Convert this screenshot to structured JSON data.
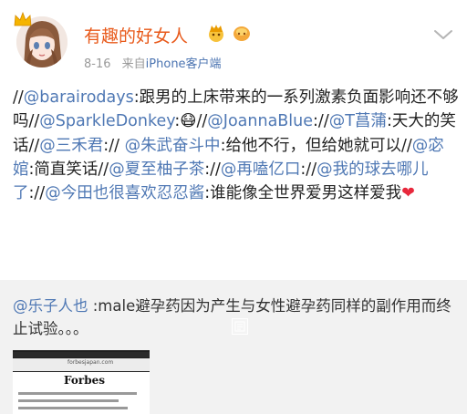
{
  "post": {
    "username": "有趣的好女人",
    "date": "8-16",
    "source_prefix": "来自",
    "device": "iPhone客户端",
    "content": [
      {
        "t": "//",
        "m": false
      },
      {
        "t": "@barairodays",
        "m": true
      },
      {
        "t": ":跟男的上床带来的一系列激素负面影响还不够吗//",
        "m": false
      },
      {
        "t": "@SparkleDonkey",
        "m": true
      },
      {
        "t": ":",
        "m": false
      },
      {
        "t": "😷",
        "m": false
      },
      {
        "t": "//",
        "m": false
      },
      {
        "t": "@JoannaBlue",
        "m": true
      },
      {
        "t": "://",
        "m": false
      },
      {
        "t": "@T菖蒲",
        "m": true
      },
      {
        "t": ":天大的笑话//",
        "m": false
      },
      {
        "t": "@三禾君",
        "m": true
      },
      {
        "t": ":// ",
        "m": false
      },
      {
        "t": "@朱武奋斗中",
        "m": true
      },
      {
        "t": ":给他不行，但给她就可以//",
        "m": false
      },
      {
        "t": "@宓婠",
        "m": true
      },
      {
        "t": ":简直笑话//",
        "m": false
      },
      {
        "t": "@夏至柚子茶",
        "m": true
      },
      {
        "t": "://",
        "m": false
      },
      {
        "t": "@再嗑亿口",
        "m": true
      },
      {
        "t": "://",
        "m": false
      },
      {
        "t": "@我的球去哪儿了",
        "m": true
      },
      {
        "t": "://",
        "m": false
      },
      {
        "t": "@今田也很喜欢忍忍酱",
        "m": true
      },
      {
        "t": ":谁能像全世界爱男这样爱我",
        "m": false
      }
    ],
    "heart": "❤"
  },
  "repost": {
    "mention": "@乐子人也",
    "text": " :male避孕药因为产生与女性避孕药同样的副作用而终止试验。。。",
    "thumbnail_site": "forbesjapan.com",
    "thumbnail_logo": "Forbes"
  },
  "icons": {
    "crown": "crown-icon",
    "badge1": "crown-badge-icon",
    "badge2": "member-badge-icon",
    "more": "chevron-down-icon"
  }
}
